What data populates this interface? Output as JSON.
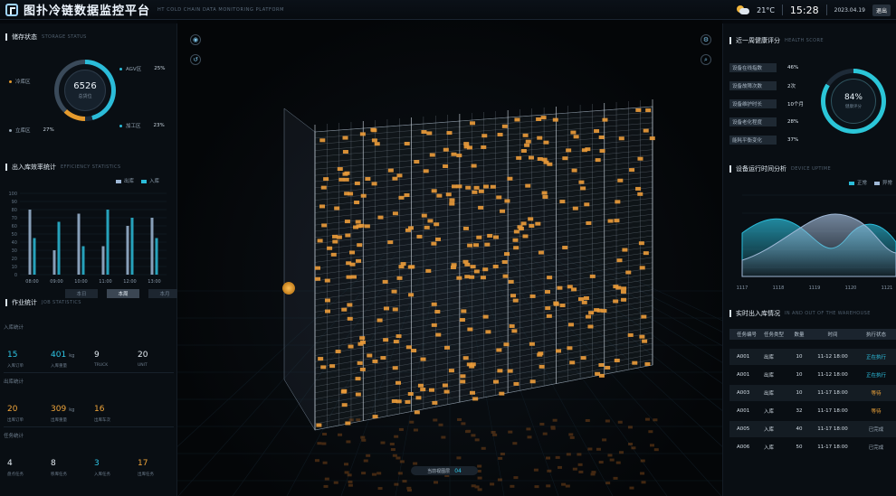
{
  "header": {
    "title": "图扑冷链数据监控平台",
    "subtitle": "HT COLD CHAIN DATA MONITORING PLATFORM",
    "temperature": "21°C",
    "time": "15:28",
    "date": "2023.04.19",
    "user_label": "退出"
  },
  "storage": {
    "title": "储存状态",
    "title_en": "STORAGE STATUS",
    "center_value": "6526",
    "center_label": "总货位",
    "legend": [
      {
        "label": "冷库区",
        "pct": "",
        "color": "#e59a2d"
      },
      {
        "label": "AGV区",
        "pct": "25%",
        "color": "#2bbcd9"
      },
      {
        "label": "立库区",
        "pct": "27%",
        "color": "#9aa9b7"
      },
      {
        "label": "加工区",
        "pct": "23%",
        "color": "#2bbcd9"
      }
    ]
  },
  "inout_stats": {
    "title": "出入库效率统计",
    "title_en": "EFFICIENCY STATISTICS",
    "legend_out": "出库",
    "legend_in": "入库",
    "color_out": "#9fb8d6",
    "color_in": "#2bbcd9"
  },
  "chart_data": {
    "type": "bar",
    "categories": [
      "08:00",
      "09:00",
      "10:00",
      "11:00",
      "12:00",
      "13:00"
    ],
    "x_ticks": [
      "08:00",
      "09:00",
      "10:00",
      "11:00",
      "12:00",
      "13:00"
    ],
    "ylim": [
      0,
      100
    ],
    "y_ticks": [
      "0",
      "10",
      "20",
      "30",
      "40",
      "50",
      "60",
      "70",
      "80",
      "90",
      "100"
    ],
    "series": [
      {
        "name": "出库",
        "values": [
          80,
          30,
          75,
          35,
          60,
          70
        ]
      },
      {
        "name": "入库",
        "values": [
          45,
          65,
          35,
          80,
          70,
          45
        ]
      }
    ]
  },
  "job_stats": {
    "title": "作业统计",
    "title_en": "JOB STATISTICS",
    "tabs": [
      "本日",
      "本周",
      "本月"
    ],
    "active_tab": 1,
    "groups": [
      {
        "title": "入库统计",
        "items": [
          {
            "value": "15",
            "unit": "",
            "label": "入库订单",
            "color": "cyan"
          },
          {
            "value": "401",
            "unit": "kg",
            "label": "入库重量",
            "color": "cyan"
          },
          {
            "value": "9",
            "unit": "",
            "label": "TRUCK",
            "color": "white"
          },
          {
            "value": "20",
            "unit": "",
            "label": "UNIT",
            "color": "white"
          }
        ]
      },
      {
        "title": "出库统计",
        "items": [
          {
            "value": "20",
            "unit": "",
            "label": "出库订单",
            "color": "orange"
          },
          {
            "value": "309",
            "unit": "kg",
            "label": "出库重量",
            "color": "orange"
          },
          {
            "value": "16",
            "unit": "",
            "label": "出库车次",
            "color": "orange"
          }
        ]
      },
      {
        "title": "任务统计",
        "items": [
          {
            "value": "4",
            "unit": "",
            "label": "盘点任务",
            "color": "white"
          },
          {
            "value": "8",
            "unit": "",
            "label": "移库任务",
            "color": "white"
          },
          {
            "value": "3",
            "unit": "",
            "label": "入库任务",
            "color": "cyan"
          },
          {
            "value": "17",
            "unit": "",
            "label": "出库任务",
            "color": "orange"
          }
        ]
      }
    ]
  },
  "health": {
    "title": "近一周健康评分",
    "title_en": "HEALTH SCORE",
    "metrics": [
      {
        "label": "设备在线指数",
        "value": "46%"
      },
      {
        "label": "设备故障次数",
        "value": "2次"
      },
      {
        "label": "设备维护时长",
        "value": "10个月"
      },
      {
        "label": "设备老化程度",
        "value": "28%"
      },
      {
        "label": "能耗平衡变化",
        "value": "37%"
      }
    ],
    "gauge_value": "84%",
    "gauge_label": "健康评分",
    "gauge_fraction": 0.84
  },
  "device_trend": {
    "title": "设备运行时间分析",
    "title_en": "DEVICE UPTIME",
    "legend": [
      "正常",
      "异常"
    ],
    "x_ticks": [
      "1117",
      "1118",
      "1119",
      "1120",
      "1121"
    ]
  },
  "realtime": {
    "title": "实时出入库情况",
    "title_en": "IN AND OUT OF THE WAREHOUSE",
    "columns": [
      "任务编号",
      "任务类型",
      "数量",
      "时间",
      "执行状态"
    ],
    "rows": [
      {
        "id": "A001",
        "type": "出库",
        "qty": "10",
        "time": "11-12 18:00",
        "status": "正在执行",
        "state": "run"
      },
      {
        "id": "A001",
        "type": "出库",
        "qty": "10",
        "time": "11-12 18:00",
        "status": "正在执行",
        "state": "run"
      },
      {
        "id": "A003",
        "type": "出库",
        "qty": "10",
        "time": "11-17 18:00",
        "status": "等待",
        "state": "wait"
      },
      {
        "id": "A001",
        "type": "入库",
        "qty": "32",
        "time": "11-17 18:00",
        "status": "等待",
        "state": "wait"
      },
      {
        "id": "A005",
        "type": "入库",
        "qty": "40",
        "time": "11-17 18:00",
        "status": "已完成",
        "state": "done"
      },
      {
        "id": "A006",
        "type": "入库",
        "qty": "50",
        "time": "11-17 18:00",
        "status": "已完成",
        "state": "done"
      }
    ]
  },
  "scene": {
    "floor_label": "当前视图层",
    "floor_value": "04"
  }
}
